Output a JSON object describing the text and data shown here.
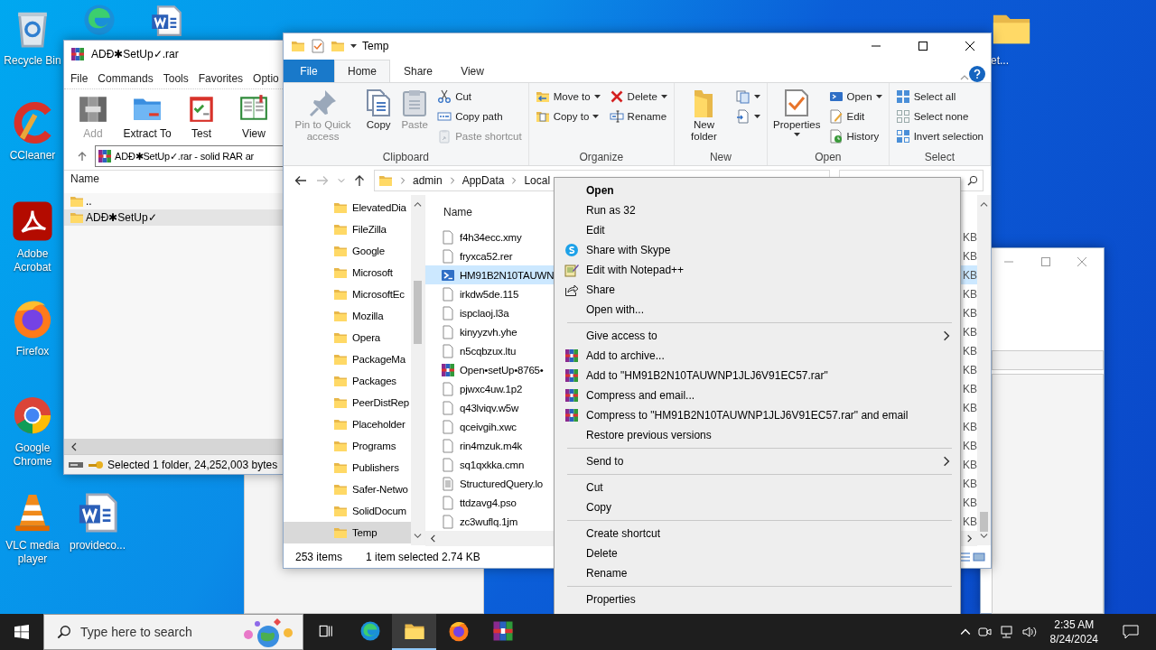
{
  "desktop_icons": [
    {
      "kind": "recycle",
      "label": "Recycle Bin"
    },
    {
      "kind": "edge"
    },
    {
      "kind": "word"
    },
    {
      "kind": "folder",
      "label": "et..."
    },
    {
      "kind": "ccleaner",
      "label": "CCleaner"
    },
    {
      "kind": "acrobat",
      "label": "Adobe Acrobat"
    },
    {
      "kind": "firefox",
      "label": "Firefox"
    },
    {
      "kind": "chrome",
      "label": "Google Chrome"
    },
    {
      "kind": "vlc",
      "label": "VLC media player"
    },
    {
      "kind": "word",
      "label": "provideco..."
    }
  ],
  "winrar": {
    "title": "ADĐ✱SetUp✓.rar",
    "menu": [
      "File",
      "Commands",
      "Tools",
      "Favorites",
      "Optio"
    ],
    "toolbar": [
      {
        "label": "Add",
        "disabled": true
      },
      {
        "label": "Extract To",
        "disabled": false
      },
      {
        "label": "Test",
        "disabled": false
      },
      {
        "label": "View",
        "disabled": false
      }
    ],
    "address": "ADĐ✱SetUp✓.rar - solid RAR ar",
    "column": "Name",
    "rows": [
      {
        "name": "..",
        "selected": false
      },
      {
        "name": "ADĐ✱SetUp✓",
        "selected": true
      }
    ],
    "status": "Selected 1 folder, 24,252,003 bytes"
  },
  "explorer": {
    "title": "Temp",
    "tabs": [
      {
        "label": "File",
        "kind": "file",
        "selected": false
      },
      {
        "label": "Home",
        "kind": "tab",
        "selected": true
      },
      {
        "label": "Share",
        "kind": "tab",
        "selected": false
      },
      {
        "label": "View",
        "kind": "tab",
        "selected": false
      }
    ],
    "groups": [
      {
        "label": "Clipboard",
        "columns": [
          [
            {
              "label": "Pin to Quick access",
              "kind": "large",
              "disabled": true
            }
          ],
          [
            {
              "label": "Copy",
              "kind": "large",
              "disabled": false
            }
          ],
          [
            {
              "label": "Paste",
              "kind": "large",
              "disabled": true
            }
          ],
          [
            {
              "label": "Cut",
              "kind": "small",
              "disabled": false
            },
            {
              "label": "Copy path",
              "kind": "small",
              "disabled": false
            },
            {
              "label": "Paste shortcut",
              "kind": "small",
              "disabled": true
            }
          ]
        ]
      },
      {
        "label": "Organize",
        "columns": [
          [
            {
              "label": "Move to",
              "kind": "small",
              "disabled": false,
              "dropdown": true
            },
            {
              "label": "Copy to",
              "kind": "small",
              "disabled": false,
              "dropdown": true
            }
          ],
          [
            {
              "label": "Delete",
              "kind": "small",
              "disabled": false,
              "dropdown": true
            },
            {
              "label": "Rename",
              "kind": "small",
              "disabled": false
            }
          ]
        ]
      },
      {
        "label": "New",
        "columns": [
          [
            {
              "label": "New folder",
              "kind": "large",
              "disabled": false
            }
          ],
          [
            {
              "kind": "small",
              "disabled": false,
              "dropdown": true
            },
            {
              "kind": "small",
              "disabled": false,
              "dropdown": true
            }
          ]
        ]
      },
      {
        "label": "Open",
        "columns": [
          [
            {
              "label": "Properties",
              "kind": "large",
              "disabled": false,
              "dropdown": true
            }
          ],
          [
            {
              "label": "Open",
              "kind": "small",
              "disabled": false,
              "dropdown": true
            },
            {
              "label": "Edit",
              "kind": "small",
              "disabled": false
            },
            {
              "label": "History",
              "kind": "small",
              "disabled": false
            }
          ]
        ]
      },
      {
        "label": "Select",
        "columns": [
          [
            {
              "label": "Select all",
              "kind": "small",
              "disabled": false
            },
            {
              "label": "Select none",
              "kind": "small",
              "disabled": false
            },
            {
              "label": "Invert selection",
              "kind": "small",
              "disabled": false
            }
          ]
        ]
      }
    ],
    "path": [
      "admin",
      "AppData",
      "Local"
    ],
    "tree": [
      {
        "label": "ElevatedDia",
        "selected": false
      },
      {
        "label": "FileZilla",
        "selected": false
      },
      {
        "label": "Google",
        "selected": false
      },
      {
        "label": "Microsoft",
        "selected": false
      },
      {
        "label": "MicrosoftEc",
        "selected": false
      },
      {
        "label": "Mozilla",
        "selected": false
      },
      {
        "label": "Opera",
        "selected": false
      },
      {
        "label": "PackageMa",
        "selected": false
      },
      {
        "label": "Packages",
        "selected": false
      },
      {
        "label": "PeerDistRep",
        "selected": false
      },
      {
        "label": "Placeholder",
        "selected": false
      },
      {
        "label": "Programs",
        "selected": false
      },
      {
        "label": "Publishers",
        "selected": false
      },
      {
        "label": "Safer-Netwo",
        "selected": false
      },
      {
        "label": "SolidDocum",
        "selected": false
      },
      {
        "label": "Temp",
        "selected": true
      }
    ],
    "column": "Name",
    "files": [
      {
        "name": "f4h34ecc.xmy",
        "kind": "file",
        "size": "KB",
        "selected": false
      },
      {
        "name": "fryxca52.rer",
        "kind": "file",
        "size": "KB",
        "selected": false
      },
      {
        "name": "HM91B2N10TAUWN",
        "kind": "script",
        "size": "KB",
        "selected": true
      },
      {
        "name": "irkdw5de.115",
        "kind": "file",
        "size": "KB",
        "selected": false
      },
      {
        "name": "ispclaoj.l3a",
        "kind": "file",
        "size": "KB",
        "selected": false
      },
      {
        "name": "kinyyzvh.yhe",
        "kind": "file",
        "size": "KB",
        "selected": false
      },
      {
        "name": "n5cqbzux.ltu",
        "kind": "file",
        "size": "KB",
        "selected": false
      },
      {
        "name": "Open•setUp•8765•",
        "kind": "archive",
        "size": "KB",
        "selected": false
      },
      {
        "name": "pjwxc4uw.1p2",
        "kind": "file",
        "size": "KB",
        "selected": false
      },
      {
        "name": "q43lviqv.w5w",
        "kind": "file",
        "size": "KB",
        "selected": false
      },
      {
        "name": "qceivgih.xwc",
        "kind": "file",
        "size": "KB",
        "selected": false
      },
      {
        "name": "rin4mzuk.m4k",
        "kind": "file",
        "size": "KB",
        "selected": false
      },
      {
        "name": "sq1qxkka.cmn",
        "kind": "file",
        "size": "KB",
        "selected": false
      },
      {
        "name": "StructuredQuery.lo",
        "kind": "log",
        "size": "KB",
        "selected": false
      },
      {
        "name": "ttdzavg4.pso",
        "kind": "file",
        "size": "KB",
        "selected": false
      },
      {
        "name": "zc3wuflq.1jm",
        "kind": "file",
        "size": "KB",
        "selected": false
      }
    ],
    "status": [
      "253 items",
      "1 item selected  2.74 KB"
    ]
  },
  "context_menu": [
    {
      "kind": "default",
      "label": "Open"
    },
    {
      "kind": "item",
      "label": "Run as 32"
    },
    {
      "kind": "item",
      "label": "Edit"
    },
    {
      "kind": "item",
      "label": "Share with Skype"
    },
    {
      "kind": "item",
      "label": "Edit with Notepad++"
    },
    {
      "kind": "item",
      "label": "Share"
    },
    {
      "kind": "item",
      "label": "Open with..."
    },
    {
      "kind": "separator"
    },
    {
      "kind": "submenu",
      "label": "Give access to"
    },
    {
      "kind": "item",
      "label": "Add to archive..."
    },
    {
      "kind": "item",
      "label": "Add to \"HM91B2N10TAUWNP1JLJ6V91EC57.rar\""
    },
    {
      "kind": "item",
      "label": "Compress and email..."
    },
    {
      "kind": "item",
      "label": "Compress to \"HM91B2N10TAUWNP1JLJ6V91EC57.rar\" and email"
    },
    {
      "kind": "item",
      "label": "Restore previous versions"
    },
    {
      "kind": "separator"
    },
    {
      "kind": "submenu",
      "label": "Send to"
    },
    {
      "kind": "separator"
    },
    {
      "kind": "item",
      "label": "Cut"
    },
    {
      "kind": "item",
      "label": "Copy"
    },
    {
      "kind": "separator"
    },
    {
      "kind": "item",
      "label": "Create shortcut"
    },
    {
      "kind": "item",
      "label": "Delete"
    },
    {
      "kind": "item",
      "label": "Rename"
    },
    {
      "kind": "separator"
    },
    {
      "kind": "item",
      "label": "Properties"
    }
  ],
  "taskbar": {
    "search_placeholder": "Type here to search",
    "apps": [
      {
        "kind": "taskview",
        "selected": false
      },
      {
        "kind": "edge",
        "selected": false
      },
      {
        "kind": "explorer",
        "selected": true
      },
      {
        "kind": "firefox",
        "selected": false
      },
      {
        "kind": "winrar",
        "selected": false
      }
    ],
    "time": "2:35 AM",
    "date": "8/24/2024"
  }
}
